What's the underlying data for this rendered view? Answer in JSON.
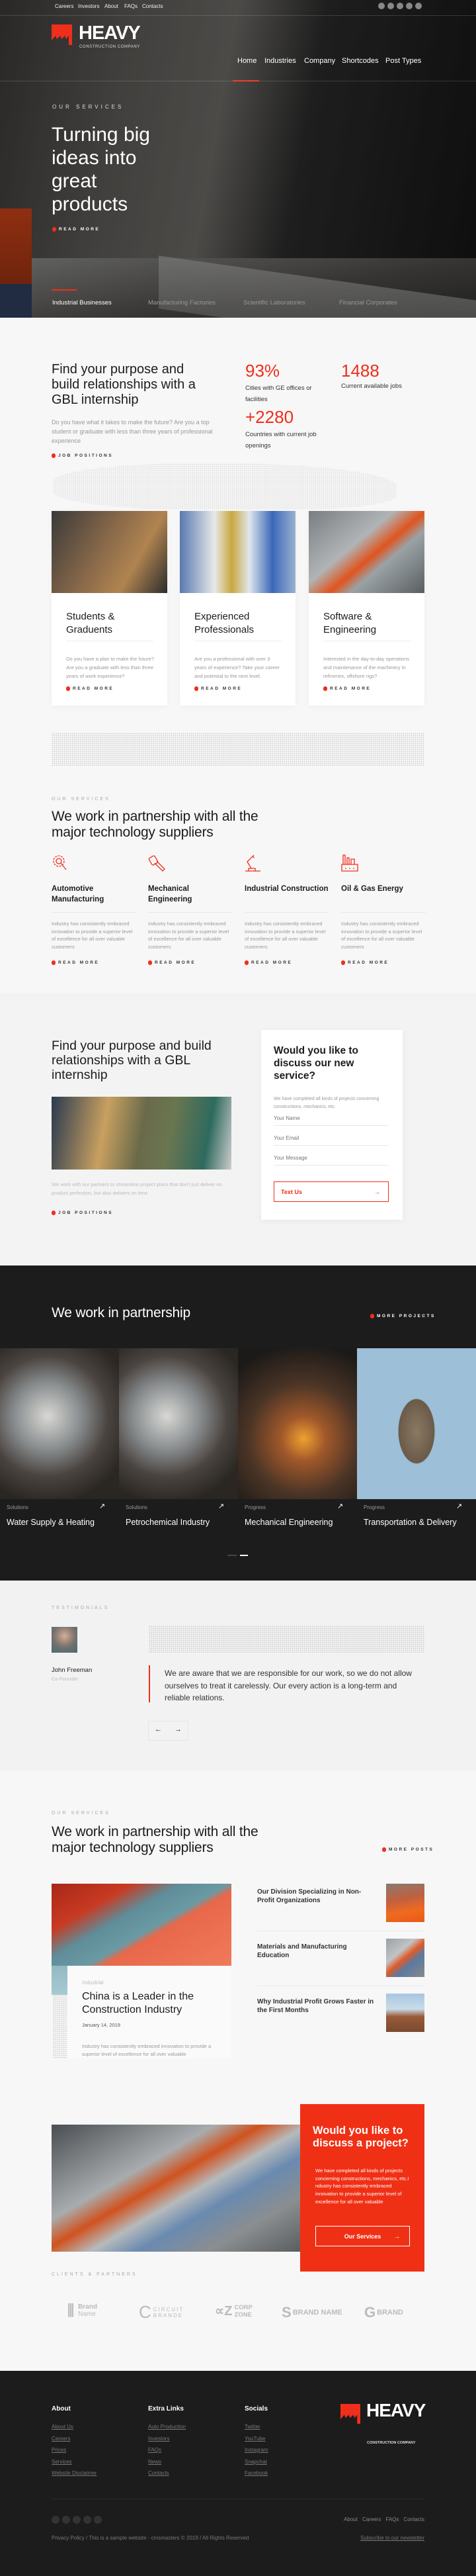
{
  "topbar": {
    "links": [
      "Careers",
      "Investors",
      "About",
      "FAQs",
      "Contacts"
    ],
    "socials": [
      "facebook-icon",
      "linkedin-icon",
      "skype-icon",
      "twitter-icon",
      "vimeo-icon"
    ]
  },
  "brand": {
    "name": "HEAVY",
    "tagline": "CONSTRUCTION COMPANY",
    "accent": "#ef2e1b"
  },
  "nav": {
    "items": [
      "Home",
      "Industries",
      "Company",
      "Shortcodes",
      "Post Types"
    ],
    "active": "Home"
  },
  "hero": {
    "eyebrow": "OUR SERVICES",
    "title": "Turning big ideas into great products",
    "cta": "READ MORE",
    "tabs": [
      "Industrial Businesses",
      "Manufacturing Factories",
      "Scientific Laboratories",
      "Financial Corporates"
    ],
    "active_tab": "Industrial Businesses"
  },
  "intern": {
    "title": "Find your purpose and build relationships with a GBL internship",
    "text": "Do you have what it takes to make the future? Are you a top student or graduate with less than three years of professional experience",
    "link": "JOB POSITIONS",
    "stats": [
      {
        "value": "93%",
        "label": "Cities with GE offices or facilities"
      },
      {
        "value": "1488",
        "label": "Current available jobs"
      },
      {
        "value": "+2280",
        "label": "Countries with current job openings"
      }
    ]
  },
  "cards": [
    {
      "title": "Students & Graduents",
      "text": "Do you have a plan to make the future? Are you a graduate with less than three years of work experience?",
      "link": "READ MORE"
    },
    {
      "title": "Experienced Professionals",
      "text": "Are you a professional with over 3 years of experience? Take your career and potential to the next level.",
      "link": "READ MORE"
    },
    {
      "title": "Software & Engineering",
      "text": "Interested in the day-to-day operations and maintenance of the machinery in refineries, offshore rigs?",
      "link": "READ MORE"
    }
  ],
  "services": {
    "eyebrow": "OUR SERVICES",
    "title": "We work in partnership with all the major technology suppliers",
    "items": [
      {
        "icon": "gear-search-icon",
        "title": "Automotive Manufacturing",
        "text": "Industry has consistently embraced innovation to provide a superior level of excellence for all over valuable customers",
        "link": "READ MORE"
      },
      {
        "icon": "wrench-icon",
        "title": "Mechanical Engineering",
        "text": "Industry has consistently embraced innovation to provide a superior level of excellence for all over valuable customers",
        "link": "READ MORE"
      },
      {
        "icon": "robot-arm-icon",
        "title": "Industrial Construction",
        "text": "Industry has consistently embraced innovation to provide a superior level of excellence for all over valuable customers",
        "link": "READ MORE"
      },
      {
        "icon": "factory-icon",
        "title": "Oil & Gas Energy",
        "text": "Industry has consistently embraced innovation to provide a superior level of excellence for all over valuable customers",
        "link": "READ MORE"
      }
    ]
  },
  "contact": {
    "title": "Find your purpose and build relationships with a GBL internship",
    "text": "We work with our partners to streamline project plans that don't just deliver on product perfection, but also delivers on time.",
    "link": "JOB POSITIONS",
    "form_title": "Would you like to discuss our new service?",
    "form_text": "We have completed all kinds of projects concerning constructions, mechanics, etc.",
    "name_placeholder": "Your Name",
    "email_placeholder": "Your Email",
    "message_placeholder": "Your Message",
    "submit": "Text Us"
  },
  "projects": {
    "title": "We work in partnership",
    "more": "MORE PROJECTS",
    "items": [
      {
        "label": "Solutions",
        "title": "Water Supply & Heating"
      },
      {
        "label": "Solutions",
        "title": "Petrochemical Industry"
      },
      {
        "label": "Progress",
        "title": "Mechanical Engineering"
      },
      {
        "label": "Progress",
        "title": "Transportation & Delivery"
      }
    ],
    "page": 2,
    "pages": 2
  },
  "testimonial": {
    "eyebrow": "TESTIMONIALS",
    "name": "John Freeman",
    "role": "Co-Founder",
    "quote": "We are aware that we are responsible for our work, so we do not allow ourselves to treat it carelessly. Our every action is a long-term and reliable relations."
  },
  "news": {
    "eyebrow": "OUR SERVICES",
    "title": "We work in partnership with all the major technology suppliers",
    "more": "MORE POSTS",
    "featured": {
      "category": "Industrial",
      "title": "China is a Leader in the Construction Industry",
      "date": "January 14, 2019",
      "text": "Industry has consistently embraced innovation to provide a superior level of excellence for all over valuable"
    },
    "posts": [
      "Our Division Specializing in Non-Profit Organizations",
      "Materials and Manufacturing Education",
      "Why Industrial Profit Grows Faster in the First Months"
    ]
  },
  "cta": {
    "title": "Would you like to discuss a project?",
    "text": "We have completed all kinds of projects concerning constructions, mechanics, etc.I ndustry has consistently embraced innovation to provide a superior level of excellence for all over valuable",
    "button": "Our Services",
    "color": "#f03015"
  },
  "clients": {
    "eyebrow": "CLIENTS & PARTNERS",
    "logos": [
      {
        "top": "Brand",
        "bottom": "Name"
      },
      {
        "top": "CIRCUIT",
        "bottom": "BRANDE"
      },
      {
        "top": "CORP",
        "bottom": "ZONE"
      },
      {
        "top": "BRAND NAME",
        "bottom": ""
      },
      {
        "top": "BRAND",
        "bottom": ""
      }
    ]
  },
  "footer": {
    "cols": [
      {
        "title": "About",
        "links": [
          "About Us",
          "Careers",
          "Prices",
          "Services",
          "Website Disclaimer"
        ]
      },
      {
        "title": "Extra Links",
        "links": [
          "Auto Production",
          "Investors",
          "FAQs",
          "News",
          "Contacts"
        ]
      },
      {
        "title": "Socials",
        "links": [
          "Twitter",
          "YouTube",
          "Instagram",
          "Snapchat",
          "Facebook"
        ]
      }
    ],
    "bottom_links": [
      "About",
      "Careers",
      "FAQs",
      "Contacts"
    ],
    "copyright": "Privacy Policy / This is a sample website - cmsmasters © 2019 / All Rights Reserved",
    "subscribe": "Subscribe to our newsletter"
  }
}
